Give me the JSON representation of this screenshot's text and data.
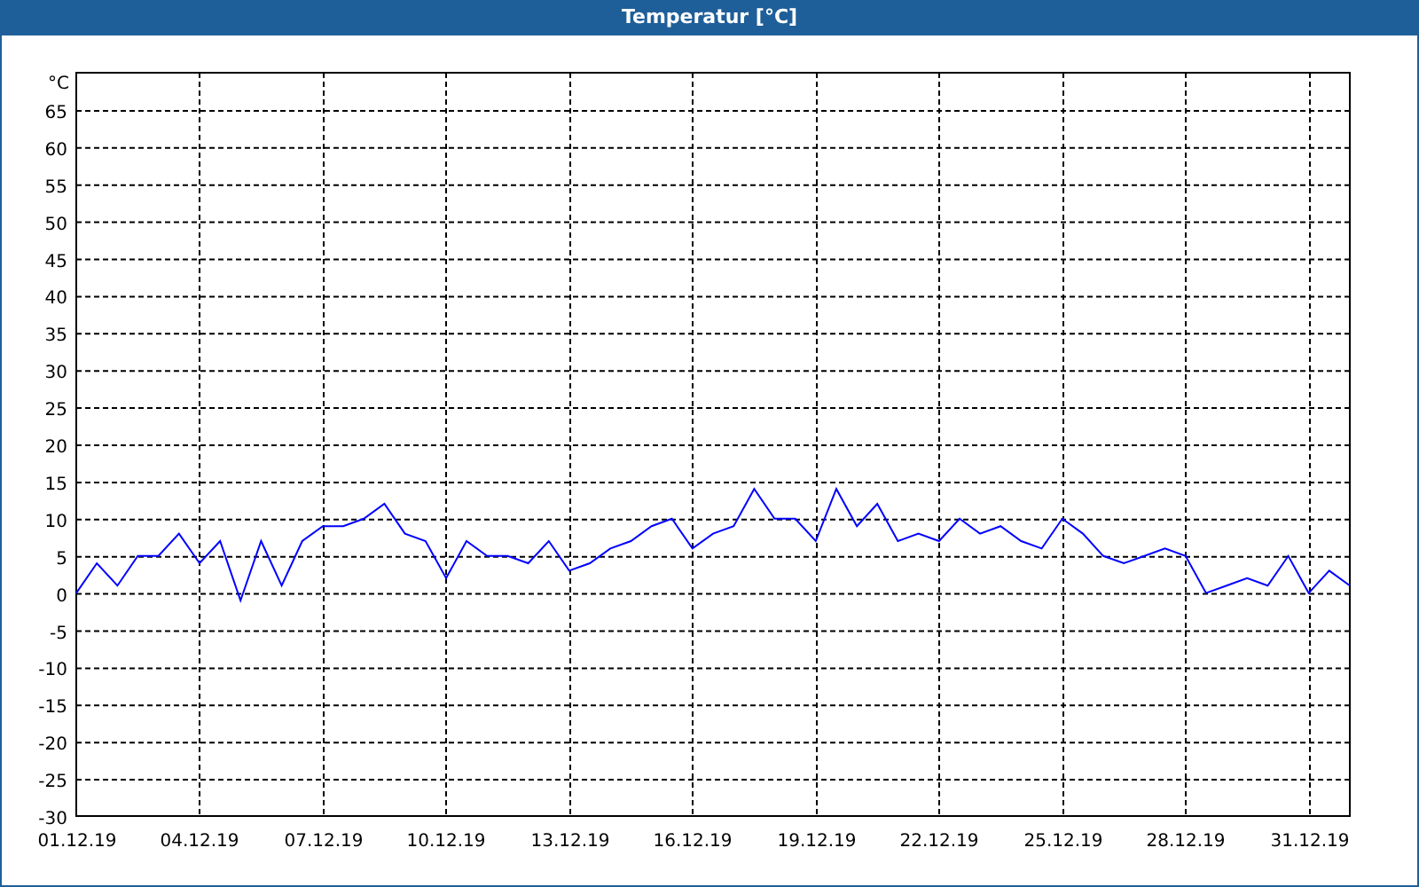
{
  "window": {
    "title": "Temperatur [°C]"
  },
  "chart": {
    "chart_data": {
      "type": "line",
      "grid": true,
      "ylabel": "°C",
      "ylim": [
        -30,
        70
      ],
      "yticks": [
        -30,
        -25,
        -20,
        -15,
        -10,
        -5,
        0,
        5,
        10,
        15,
        20,
        25,
        30,
        35,
        40,
        45,
        50,
        55,
        60,
        65
      ],
      "categories": [
        "01.12.19",
        null,
        null,
        null,
        null,
        null,
        "04.12.19",
        null,
        null,
        null,
        null,
        null,
        "07.12.19",
        null,
        null,
        null,
        null,
        null,
        "10.12.19",
        null,
        null,
        null,
        null,
        null,
        "13.12.19",
        null,
        null,
        null,
        null,
        null,
        "16.12.19",
        null,
        null,
        null,
        null,
        null,
        "19.12.19",
        null,
        null,
        null,
        null,
        null,
        "22.12.19",
        null,
        null,
        null,
        null,
        null,
        "25.12.19",
        null,
        null,
        null,
        null,
        null,
        "28.12.19",
        null,
        null,
        null,
        null,
        null,
        "31.12.19",
        null,
        null
      ],
      "series": [
        {
          "color": "#0000ff",
          "values": [
            0,
            4,
            1,
            5,
            5,
            8,
            4,
            7,
            -1,
            7,
            1,
            7,
            9,
            9,
            10,
            12,
            8,
            7,
            2,
            7,
            5,
            5,
            4,
            7,
            3,
            4,
            6,
            7,
            9,
            10,
            6,
            8,
            9,
            14,
            10,
            10,
            7,
            14,
            9,
            12,
            7,
            8,
            7,
            10,
            8,
            9,
            7,
            6,
            10,
            8,
            5,
            4,
            5,
            6,
            5,
            0,
            1,
            2,
            1,
            5,
            0,
            3,
            1
          ]
        }
      ]
    }
  }
}
